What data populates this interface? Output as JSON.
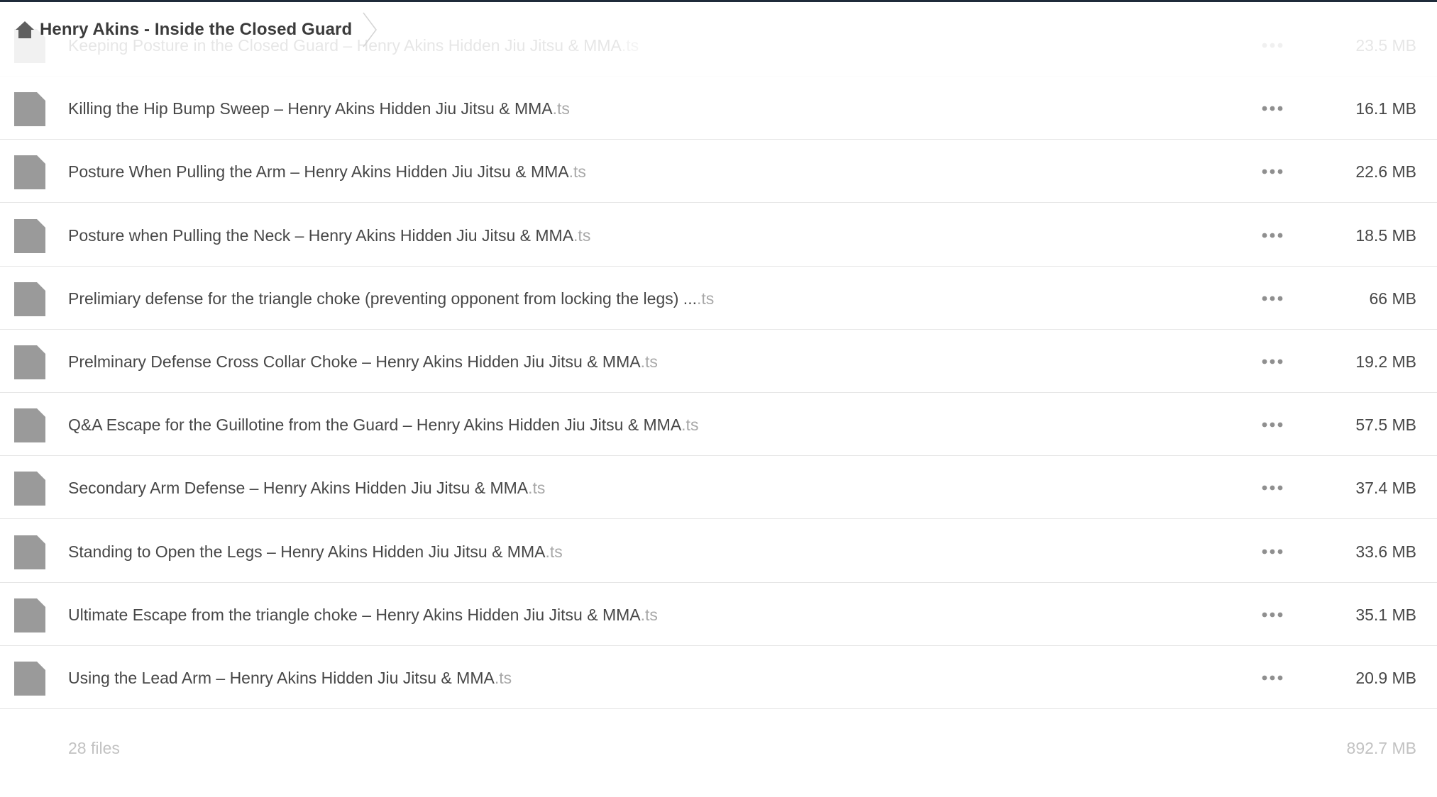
{
  "breadcrumb": {
    "home_icon": "home-icon",
    "title": "Henry Akins - Inside the Closed Guard"
  },
  "files": [
    {
      "name": "Keeping Posture in the Closed Guard – Henry Akins Hidden Jiu Jitsu & MMA",
      "ext": ".ts",
      "size": "23.5 MB",
      "partial": true
    },
    {
      "name": "Killing the Hip Bump Sweep – Henry Akins Hidden Jiu Jitsu & MMA",
      "ext": ".ts",
      "size": "16.1 MB"
    },
    {
      "name": "Posture When Pulling the Arm – Henry Akins Hidden Jiu Jitsu & MMA",
      "ext": ".ts",
      "size": "22.6 MB"
    },
    {
      "name": "Posture when Pulling the Neck – Henry Akins Hidden Jiu Jitsu & MMA",
      "ext": ".ts",
      "size": "18.5 MB"
    },
    {
      "name": "Prelimiary defense for the triangle choke (preventing opponent from locking the legs) ...",
      "ext": ".ts",
      "size": "66 MB"
    },
    {
      "name": "Prelminary Defense Cross Collar Choke – Henry Akins Hidden Jiu Jitsu & MMA",
      "ext": ".ts",
      "size": "19.2 MB"
    },
    {
      "name": "Q&A Escape for the Guillotine from the Guard – Henry Akins Hidden Jiu Jitsu & MMA",
      "ext": ".ts",
      "size": "57.5 MB"
    },
    {
      "name": "Secondary Arm Defense – Henry Akins Hidden Jiu Jitsu & MMA",
      "ext": ".ts",
      "size": "37.4 MB"
    },
    {
      "name": "Standing to Open the Legs – Henry Akins Hidden Jiu Jitsu & MMA",
      "ext": ".ts",
      "size": "33.6 MB"
    },
    {
      "name": "Ultimate Escape from the triangle choke – Henry Akins Hidden Jiu Jitsu & MMA",
      "ext": ".ts",
      "size": "35.1 MB"
    },
    {
      "name": "Using the Lead Arm – Henry Akins Hidden Jiu Jitsu & MMA",
      "ext": ".ts",
      "size": "20.9 MB"
    }
  ],
  "footer": {
    "count": "28 files",
    "total_size": "892.7 MB"
  },
  "colors": {
    "top_border": "#1f2b3a",
    "icon_gray": "#9a9a9a",
    "text": "#474747",
    "muted": "#c2c2c2"
  }
}
